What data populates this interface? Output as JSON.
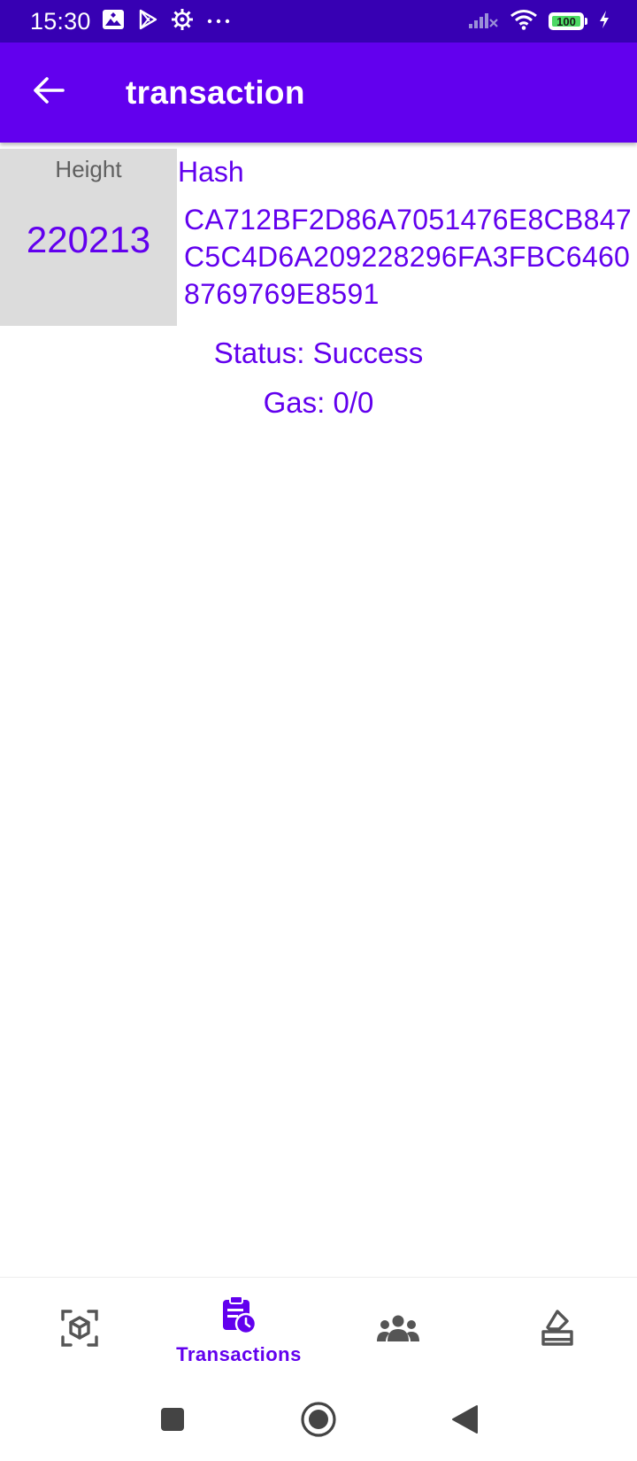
{
  "status_bar": {
    "time": "15:30",
    "battery": "100",
    "icons": [
      "photos-icon",
      "play-store-icon",
      "settings-gear-icon",
      "more-dots-icon",
      "signal-icon",
      "wifi-icon",
      "battery-icon",
      "charging-icon"
    ]
  },
  "app_bar": {
    "title": "transaction",
    "back_icon": "arrow-back-icon",
    "background": "#6200ee"
  },
  "transaction": {
    "height_label": "Height",
    "height_value": "220213",
    "hash_label": "Hash",
    "hash_value": "CA712BF2D86A7051476E8CB847C5C4D6A209228296FA3FBC64608769769E8591",
    "status": "Status: Success",
    "gas": "Gas: 0/0"
  },
  "bottom_nav": {
    "items": [
      {
        "icon": "cube-scan-icon",
        "label": "",
        "active": false
      },
      {
        "icon": "clipboard-clock-icon",
        "label": "Transactions",
        "active": true
      },
      {
        "icon": "people-group-icon",
        "label": "",
        "active": false
      },
      {
        "icon": "eraser-tray-icon",
        "label": "",
        "active": false
      }
    ]
  },
  "system_nav": {
    "buttons": [
      "recents-square-icon",
      "home-circle-icon",
      "back-triangle-icon"
    ]
  },
  "colors": {
    "primary": "#6200ee",
    "primary_dark": "#3700b3",
    "height_cell_bg": "#dcdcdc"
  }
}
